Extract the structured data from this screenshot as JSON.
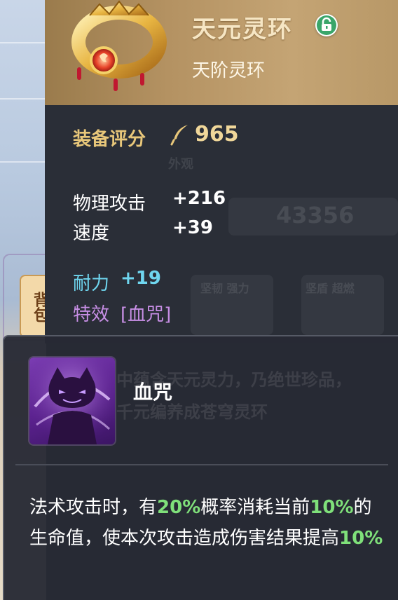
{
  "item": {
    "name": "天元灵环",
    "tier": "天阶灵环",
    "icon": "golden-ring-icon",
    "lock_icon": "unlock-icon"
  },
  "score": {
    "label": "装备评分",
    "icon": "quill-icon",
    "value": "965"
  },
  "stats": [
    {
      "label": "物理攻击",
      "value": "+216"
    },
    {
      "label": "速度",
      "value": "+39"
    }
  ],
  "endurance": {
    "label": "耐力",
    "value": "+19"
  },
  "effect": {
    "label": "特效",
    "value": "[血咒]"
  },
  "background_text": {
    "appearance": "外观",
    "power": "43356",
    "tab": "背包",
    "card_1": "坚韧  强力",
    "card_2": "坚盾  超燃",
    "lore_1": "中蕴含天元灵力，乃绝世珍品，",
    "lore_2": "千元编养成苍穹灵环"
  },
  "skill": {
    "name": "血咒",
    "icon": "cursed-cat-icon",
    "desc": {
      "part1": "法术攻击时，有",
      "chance": "20%",
      "part2": "概率消耗当前",
      "hp_pct": "10%",
      "part3": "的生命值，使本次攻击造成伤害结果提高",
      "dmg_pct": "10%"
    }
  },
  "colors": {
    "header_gold": "#b49262",
    "score_gold": "#e8c77a",
    "endurance_cyan": "#6fd6ef",
    "effect_purple": "#c88fe6",
    "highlight_green": "#7fe07a",
    "lock_green": "#3aa66a"
  }
}
